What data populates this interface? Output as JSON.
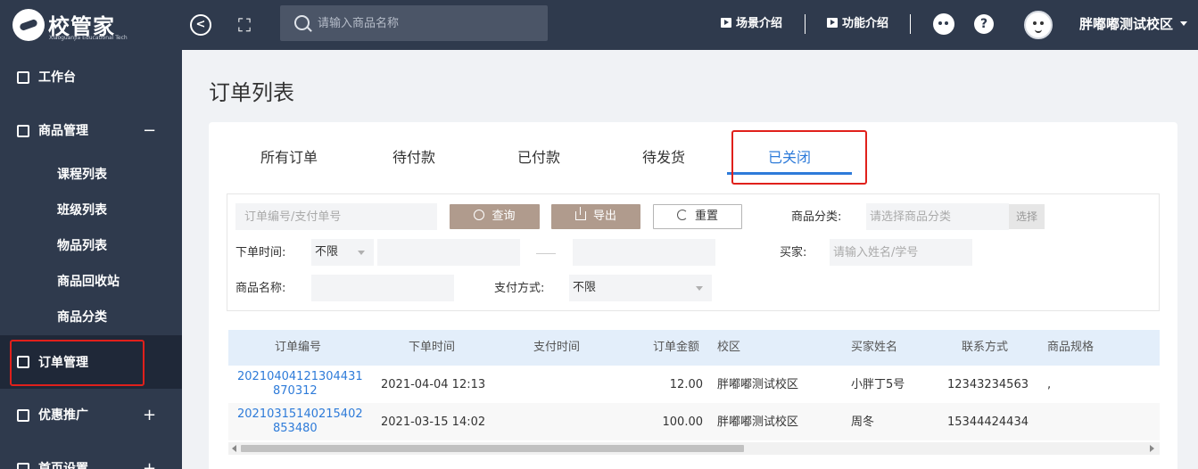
{
  "header": {
    "logo_text": "校管家",
    "logo_subtext": "Xiaoguanjia Educational Tech",
    "search_placeholder": "请输入商品名称",
    "scene_intro": "场景介绍",
    "feature_intro": "功能介绍",
    "school_name": "胖嘟嘟测试校区"
  },
  "sidebar": {
    "workbench": "工作台",
    "product_mgmt": "商品管理",
    "product_sign": "−",
    "sub_items": [
      "课程列表",
      "班级列表",
      "物品列表",
      "商品回收站",
      "商品分类"
    ],
    "order_mgmt": "订单管理",
    "promotion": "优惠推广",
    "promotion_sign": "+",
    "homepage_settings": "首页设置",
    "homepage_sign": "+"
  },
  "page": {
    "title": "订单列表",
    "tabs": [
      "所有订单",
      "待付款",
      "已付款",
      "待发货",
      "已关闭"
    ],
    "active_tab": "已关闭"
  },
  "filters": {
    "order_no_placeholder": "订单编号/支付单号",
    "query_label": "查询",
    "export_label": "导出",
    "reset_label": "重置",
    "category_label": "商品分类:",
    "category_placeholder": "请选择商品分类",
    "choose_label": "选择",
    "order_time_label": "下单时间:",
    "order_time_value": "不限",
    "buyer_label": "买家:",
    "buyer_placeholder": "请输入姓名/学号",
    "product_name_label": "商品名称:",
    "pay_method_label": "支付方式:",
    "pay_method_value": "不限"
  },
  "table": {
    "headers": [
      "订单编号",
      "下单时间",
      "支付时间",
      "订单金额",
      "校区",
      "买家姓名",
      "联系方式",
      "商品规格"
    ],
    "rows": [
      {
        "order_no_1": "20210404121304431",
        "order_no_2": "870312",
        "order_time": "2021-04-04 12:13",
        "pay_time": "",
        "amount": "12.00",
        "campus": "胖嘟嘟测试校区",
        "buyer": "小胖丁5号",
        "contact": "12343234563",
        "spec": ","
      },
      {
        "order_no_1": "20210315140215402",
        "order_no_2": "853480",
        "order_time": "2021-03-15 14:02",
        "pay_time": "",
        "amount": "100.00",
        "campus": "胖嘟嘟测试校区",
        "buyer": "周冬",
        "contact": "15344424434",
        "spec": ""
      }
    ]
  },
  "colors": {
    "header_bg": "#2f3a4d",
    "accent": "#2e7bd9",
    "highlight_box": "#e0201b",
    "button_brown": "#b09b8d"
  }
}
